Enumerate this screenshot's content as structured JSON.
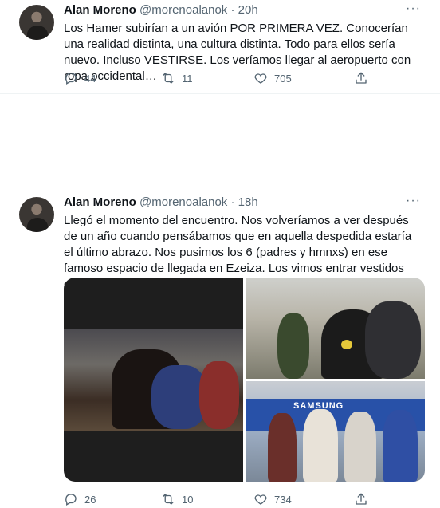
{
  "tweets": [
    {
      "name": "Alan Moreno",
      "handle": "@morenoalanok",
      "separator": "·",
      "time": "20h",
      "more": "···",
      "text": "Los Hamer subirían a un avión POR PRIMERA VEZ. Conocerían una realidad distinta, una cultura distinta. Todo para ellos sería nuevo. Incluso VESTIRSE. Los veríamos llegar al aeropuerto con ropa occidental…",
      "replies": "44",
      "retweets": "11",
      "likes": "705"
    },
    {
      "name": "Alan Moreno",
      "handle": "@morenoalanok",
      "separator": "·",
      "time": "18h",
      "more": "···",
      "text": "Llegó el momento del encuentro. Nos volveríamos a ver después de un año cuando pensábamos que en aquella despedida estaría el último abrazo. Nos pusimos los 6 (padres y hmnxs) en ese famoso espacio de llegada en Ezeiza. Los vimos entrar vestidos como nosotros…llanto.",
      "media_banner_text": "SAMSUNG",
      "replies": "26",
      "retweets": "10",
      "likes": "734"
    }
  ],
  "icons": {
    "reply": "reply-icon",
    "retweet": "retweet-icon",
    "like": "heart-icon",
    "share": "share-icon"
  },
  "colors": {
    "text": "#0f1419",
    "secondary": "#536471",
    "divider": "#eff3f4"
  }
}
